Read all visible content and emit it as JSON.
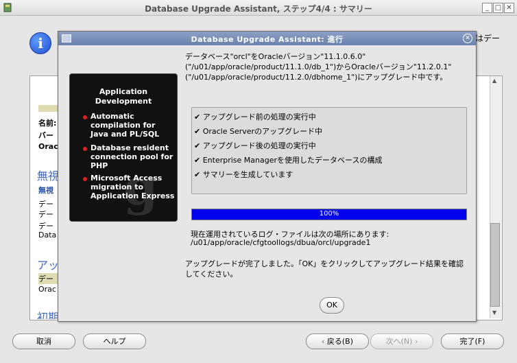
{
  "window": {
    "title": "Database Upgrade Assistant, ステップ4/4 : サマリー",
    "controls": [
      "_",
      "□",
      "✕"
    ]
  },
  "background": {
    "header_right_text": "はデー",
    "lines": [
      "名前:",
      "バー",
      "Orac",
      "無視",
      "無視",
      "デー",
      "デー",
      "デー",
      "Data",
      "アッ",
      "デー",
      "Orac",
      "初期"
    ]
  },
  "buttons": {
    "cancel": "取消",
    "help": "ヘルプ",
    "back": "戻る(B)",
    "next": "次へ(N)",
    "finish": "完了(F)"
  },
  "dialog": {
    "title": "Database Upgrade Assistant: 進行",
    "intro": "データベース\"orcl\"をOracleバージョン\"11.1.0.6.0\"(\"/u01/app/oracle/product/11.1.0/db_1\")からOracleバージョン\"11.2.0.1\"(\"/u01/app/oracle/product/11.2.0/dbhome_1\")にアップグレード中です。",
    "steps": [
      "✔ アップグレード前の処理の実行中",
      "✔ Oracle Serverのアップグレード中",
      "✔ アップグレード後の処理の実行中",
      "✔ Enterprise Managerを使用したデータベースの構成",
      "✔ サマリーを生成しています"
    ],
    "progress": {
      "label": "100%",
      "value": 100
    },
    "log_label": "現在運用されているログ・ファイルは次の場所にあります:",
    "log_path": "/u01/app/oracle/cfgtoollogs/dbua/orcl/upgrade1",
    "done_message": "アップグレードが完了しました。「OK」をクリックしてアップグレード結果を確認してください。",
    "ok": "OK"
  },
  "promo": {
    "title": "Application\nDevelopment",
    "items": [
      "Automatic compilation for Java and PL/SQL",
      "Database resident connection pool for PHP",
      "Microsoft Access migration to Application Express"
    ],
    "watermark": "g"
  },
  "colors": {
    "progress": "#0000ee",
    "dialog_title": "#6a82ad",
    "bullet": "#e02020"
  }
}
